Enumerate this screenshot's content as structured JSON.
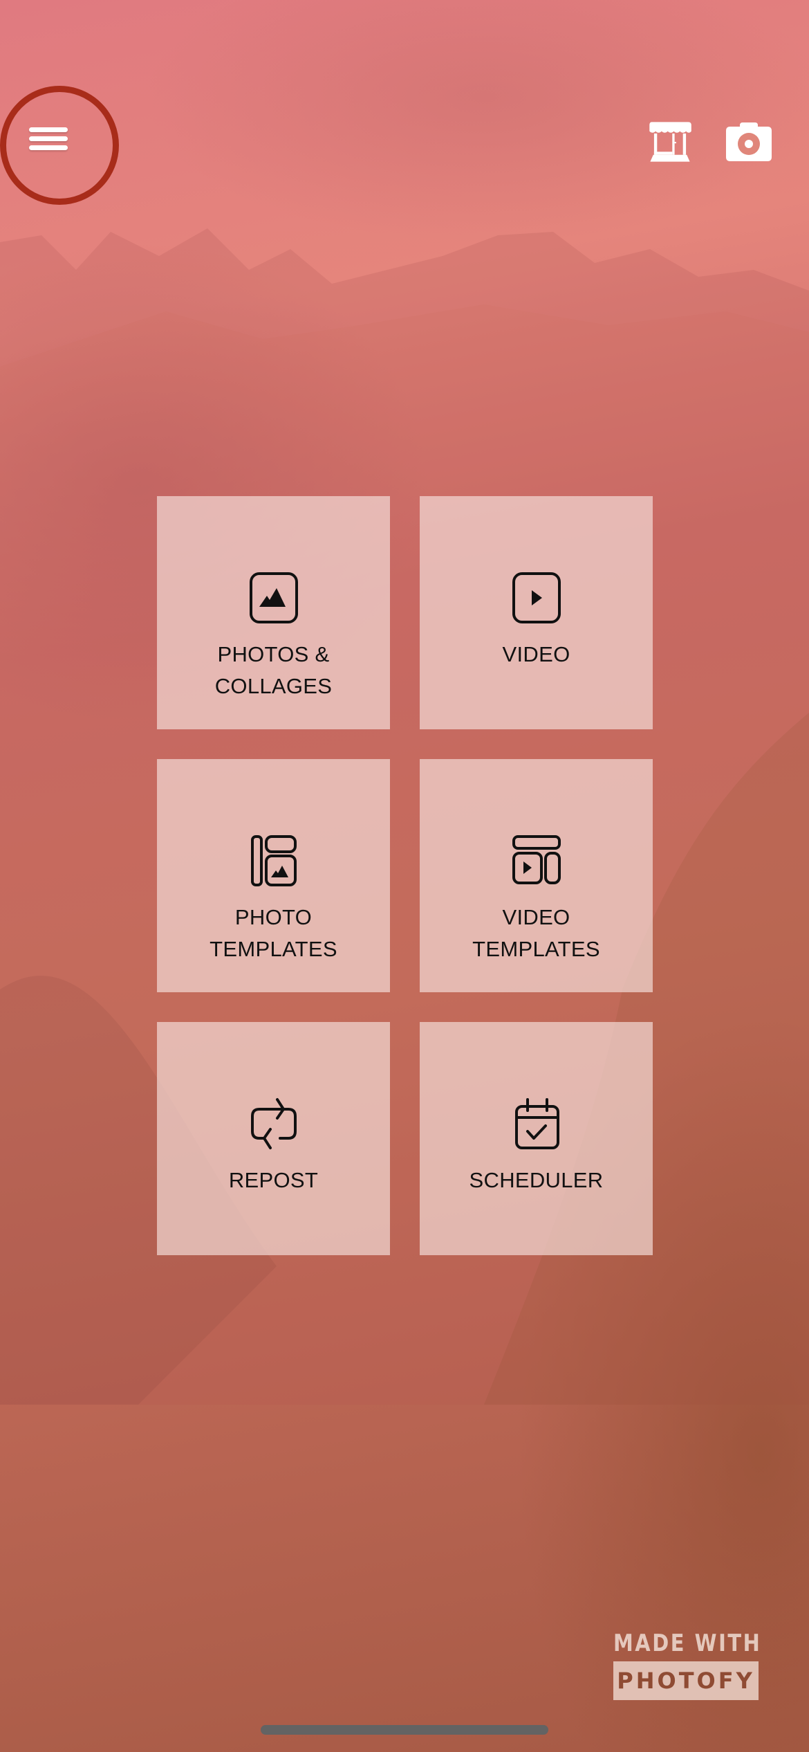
{
  "app": {
    "background": "mountain-landscape-pink-tint",
    "accent_ring_color": "#a82c1a"
  },
  "header": {
    "menu_icon": "hamburger-menu-icon",
    "store_icon": "storefront-icon",
    "camera_icon": "camera-icon"
  },
  "tiles": [
    {
      "label": "PHOTOS &\nCOLLAGES",
      "icon": "photo-icon"
    },
    {
      "label": "VIDEO",
      "icon": "video-play-icon"
    },
    {
      "label": "PHOTO\nTEMPLATES",
      "icon": "photo-template-icon"
    },
    {
      "label": "VIDEO\nTEMPLATES",
      "icon": "video-template-icon"
    },
    {
      "label": "REPOST",
      "icon": "repost-icon"
    },
    {
      "label": "SCHEDULER",
      "icon": "calendar-check-icon"
    }
  ],
  "watermark": {
    "line1": "MADE WITH",
    "line2": "PHOTOFY"
  }
}
